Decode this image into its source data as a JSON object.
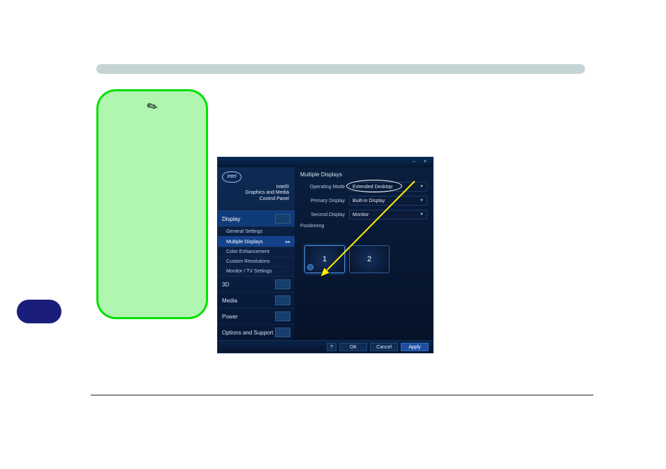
{
  "panel": {
    "logo_text": "intel",
    "brand_line1": "Intel®",
    "brand_line2": "Graphics and Media",
    "brand_line3": "Control Panel",
    "titlebar": {
      "min": "–",
      "close": "×"
    },
    "nav": {
      "display": "Display",
      "sub": {
        "general": "General Settings",
        "multiple": "Multiple Displays",
        "color": "Color Enhancement",
        "custom": "Custom Resolutions",
        "monitor": "Monitor / TV Settings"
      },
      "threeD": "3D",
      "media": "Media",
      "power": "Power",
      "options": "Options and Support"
    },
    "main": {
      "section": "Multiple Displays",
      "fields": {
        "op_mode_label": "Operating Mode",
        "op_mode_value": "Extended Desktop",
        "primary_label": "Primary Display",
        "primary_value": "Built-in Display",
        "second_label": "Second Display",
        "second_value": "Monitor"
      },
      "positioning": "Positioning",
      "d1": "1",
      "d2": "2"
    },
    "buttons": {
      "help": "?",
      "ok": "OK",
      "cancel": "Cancel",
      "apply": "Apply"
    }
  }
}
